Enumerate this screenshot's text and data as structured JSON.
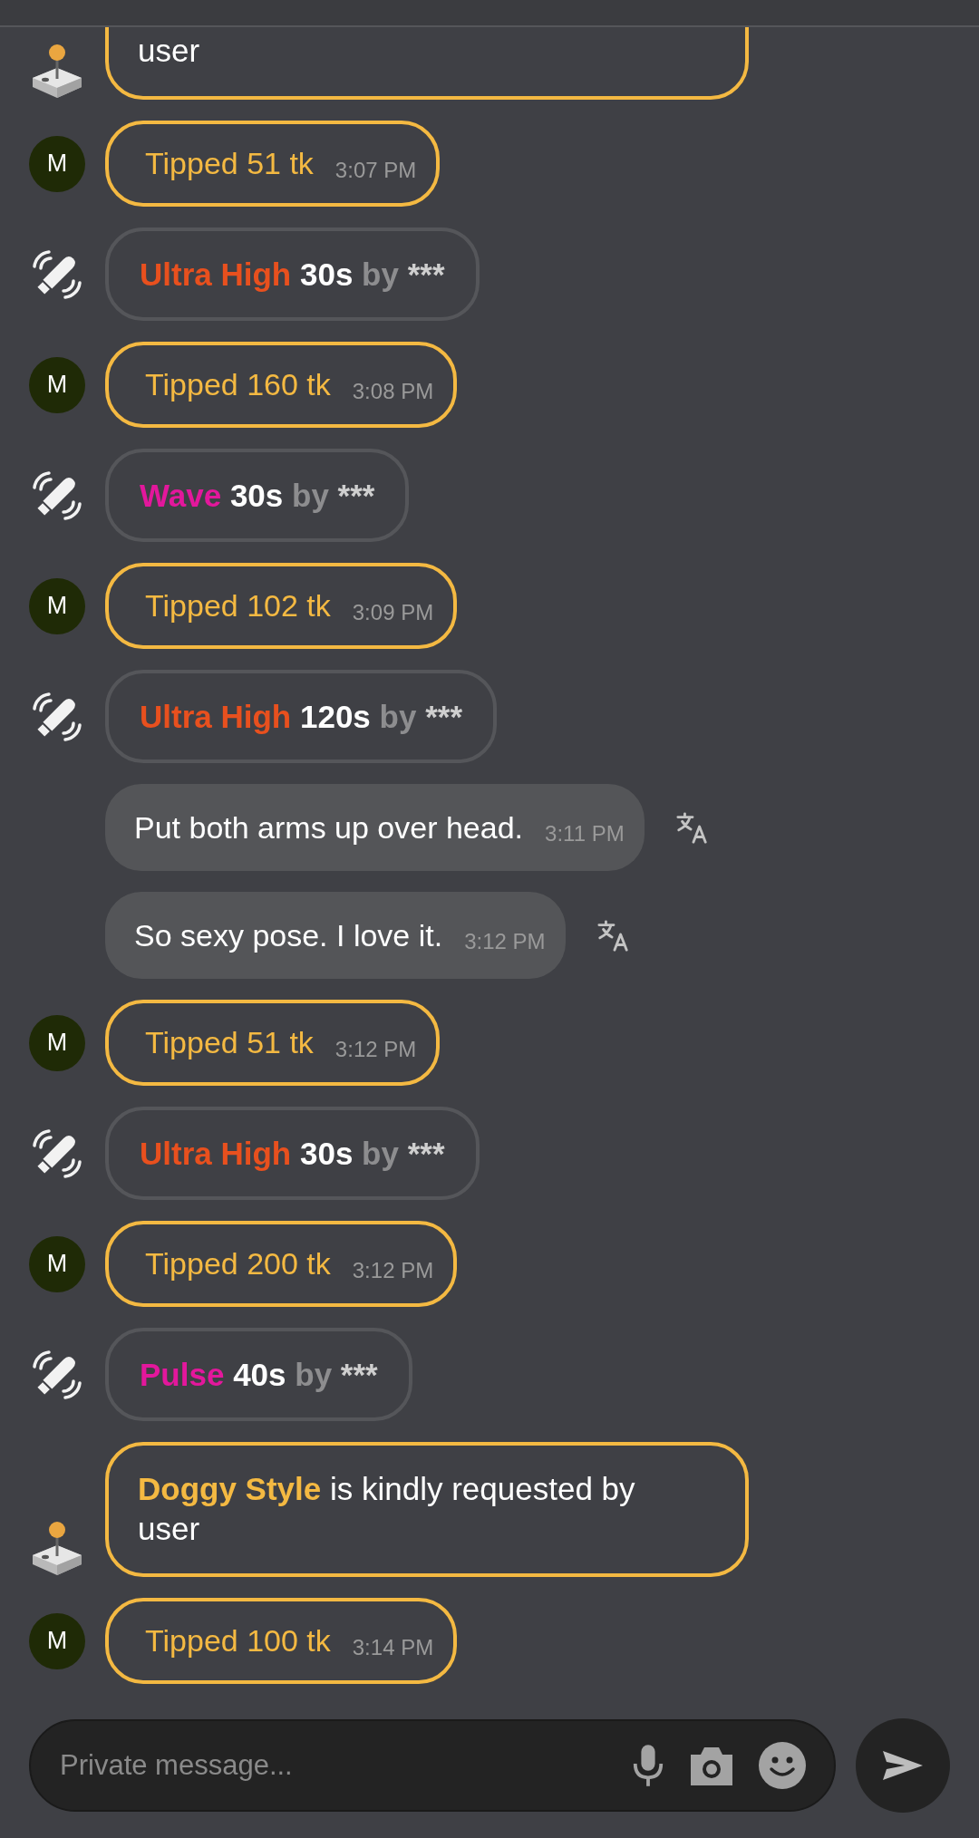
{
  "messages": [
    {
      "kind": "request",
      "text": "user"
    },
    {
      "kind": "tip",
      "avatar": "M",
      "text": "Tipped 51 tk",
      "time": "3:07 PM"
    },
    {
      "kind": "toy",
      "pattern": "Ultra High",
      "color": "#e8501e",
      "duration": "30s",
      "by": "by",
      "user": "***"
    },
    {
      "kind": "tip",
      "avatar": "M",
      "text": "Tipped 160 tk",
      "time": "3:08 PM"
    },
    {
      "kind": "toy",
      "pattern": "Wave",
      "color": "#e3179c",
      "duration": "30s",
      "by": "by",
      "user": "***"
    },
    {
      "kind": "tip",
      "avatar": "M",
      "text": "Tipped 102 tk",
      "time": "3:09 PM"
    },
    {
      "kind": "toy",
      "pattern": "Ultra High",
      "color": "#e8501e",
      "duration": "120s",
      "by": "by",
      "user": "***"
    },
    {
      "kind": "chat",
      "text": "Put both arms up over head.",
      "time": "3:11 PM"
    },
    {
      "kind": "chat",
      "text": "So sexy pose. I love it.",
      "time": "3:12 PM"
    },
    {
      "kind": "tip",
      "avatar": "M",
      "text": "Tipped 51 tk",
      "time": "3:12 PM"
    },
    {
      "kind": "toy",
      "pattern": "Ultra High",
      "color": "#e8501e",
      "duration": "30s",
      "by": "by",
      "user": "***"
    },
    {
      "kind": "tip",
      "avatar": "M",
      "text": "Tipped 200 tk",
      "time": "3:12 PM"
    },
    {
      "kind": "toy",
      "pattern": "Pulse",
      "color": "#e3179c",
      "duration": "40s",
      "by": "by",
      "user": "***"
    },
    {
      "kind": "request",
      "highlight": "Doggy Style",
      "text": "is kindly requested by user"
    },
    {
      "kind": "tip",
      "avatar": "M",
      "text": "Tipped 100 tk",
      "time": "3:14 PM"
    }
  ],
  "composer": {
    "placeholder": "Private message..."
  }
}
